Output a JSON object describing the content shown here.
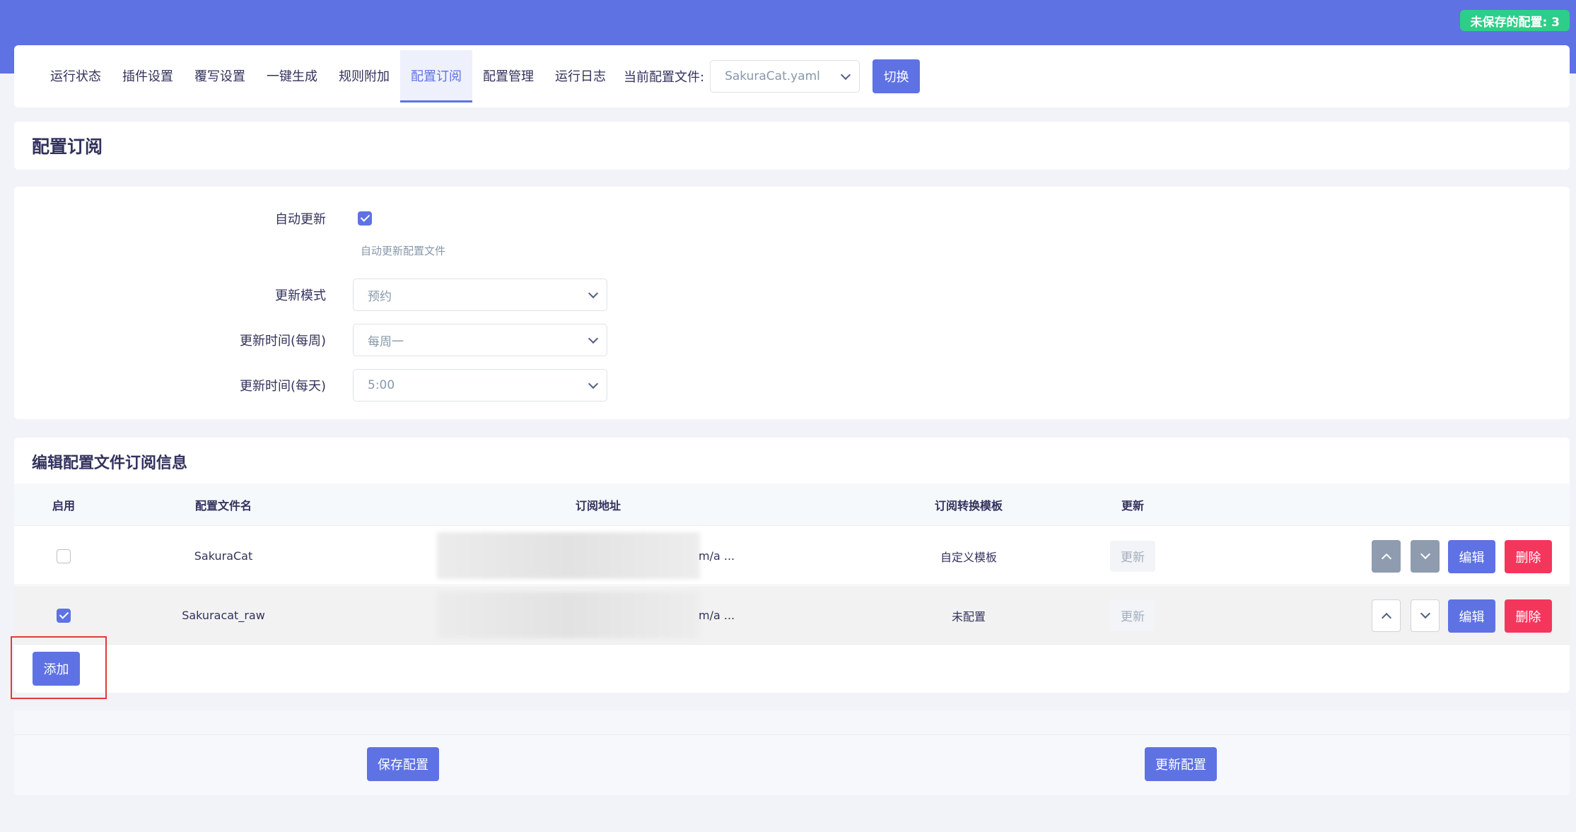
{
  "header": {
    "unsaved_badge": "未保存的配置: 3"
  },
  "nav": {
    "tabs": [
      {
        "label": "运行状态",
        "active": false
      },
      {
        "label": "插件设置",
        "active": false
      },
      {
        "label": "覆写设置",
        "active": false
      },
      {
        "label": "一键生成",
        "active": false
      },
      {
        "label": "规则附加",
        "active": false
      },
      {
        "label": "配置订阅",
        "active": true
      },
      {
        "label": "配置管理",
        "active": false
      },
      {
        "label": "运行日志",
        "active": false
      }
    ],
    "current_config_label": "当前配置文件:",
    "current_config_value": "SakuraCat.yaml",
    "switch_button": "切换"
  },
  "page_title": "配置订阅",
  "form": {
    "auto_update_label": "自动更新",
    "auto_update_checked": true,
    "auto_update_help": "自动更新配置文件",
    "update_mode_label": "更新模式",
    "update_mode_value": "预约",
    "weekly_label": "更新时间(每周)",
    "weekly_value": "每周一",
    "daily_label": "更新时间(每天)",
    "daily_value": "5:00"
  },
  "subscriptions": {
    "title": "编辑配置文件订阅信息",
    "columns": [
      "启用",
      "配置文件名",
      "订阅地址",
      "订阅转换模板",
      "更新"
    ],
    "rows": [
      {
        "enabled": false,
        "name": "SakuraCat",
        "url_tail": "m/a ...",
        "template": "自定义模板",
        "update": "更新"
      },
      {
        "enabled": true,
        "name": "Sakuracat_raw",
        "url_tail": "m/a ...",
        "template": "未配置",
        "update": "更新"
      }
    ],
    "edit_button": "编辑",
    "delete_button": "删除",
    "add_button": "添加"
  },
  "footer": {
    "save_button": "保存配置",
    "update_button": "更新配置"
  },
  "colors": {
    "primary": "#5e72e4",
    "danger": "#f5365c",
    "success": "#2dce89"
  }
}
